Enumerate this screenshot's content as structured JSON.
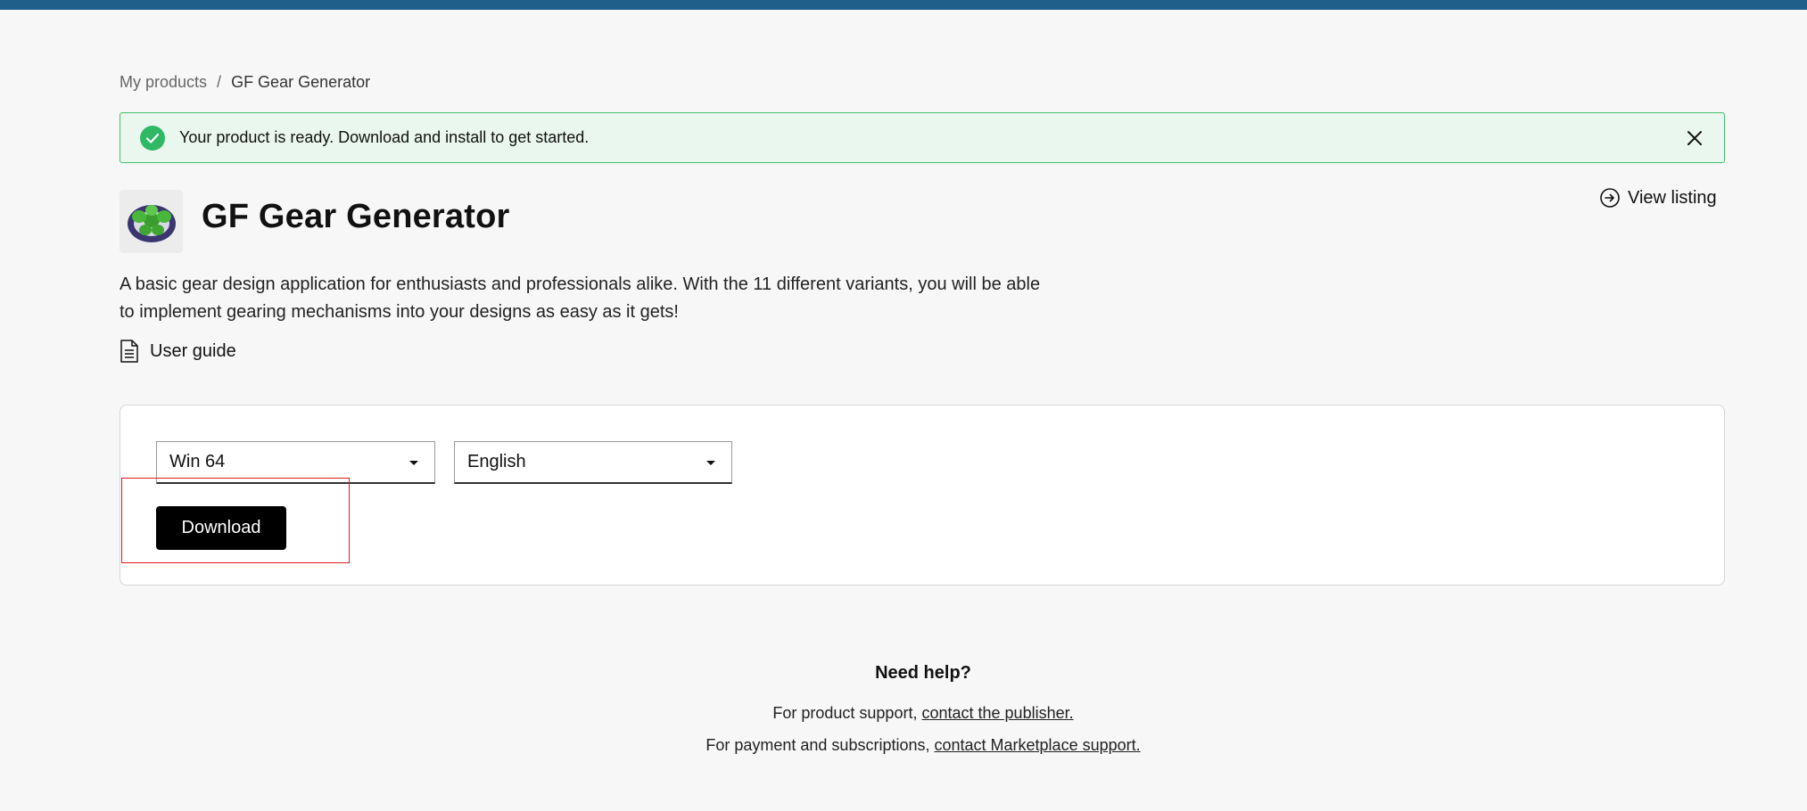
{
  "colors": {
    "topbar": "#1f5f8a",
    "alert_background": "#eaf7ee",
    "alert_border": "#40c06c",
    "success_icon": "#2fb866",
    "primary_button": "#000000",
    "highlight": "#e01b1b"
  },
  "breadcrumb": {
    "parent": "My products",
    "separator": "/",
    "current": "GF Gear Generator"
  },
  "alert": {
    "icon": "check-circle-icon",
    "message": "Your product is ready. Download and install to get started.",
    "close_icon": "close-icon"
  },
  "product": {
    "title": "GF Gear Generator",
    "icon": "gear-app-icon",
    "description": "A basic gear design application for enthusiasts and professionals alike. With the 11 different variants, you will be able to implement gearing mechanisms into your designs as easy as it gets!",
    "view_listing_label": "View listing",
    "user_guide_label": "User guide"
  },
  "download_card": {
    "os_select": {
      "value": "Win 64"
    },
    "language_select": {
      "value": "English"
    },
    "download_label": "Download"
  },
  "help": {
    "title": "Need help?",
    "product_support_prefix": "For product support,",
    "product_support_link": "contact the publisher.",
    "payment_prefix": "For payment and subscriptions,",
    "payment_link": "contact Marketplace support."
  }
}
